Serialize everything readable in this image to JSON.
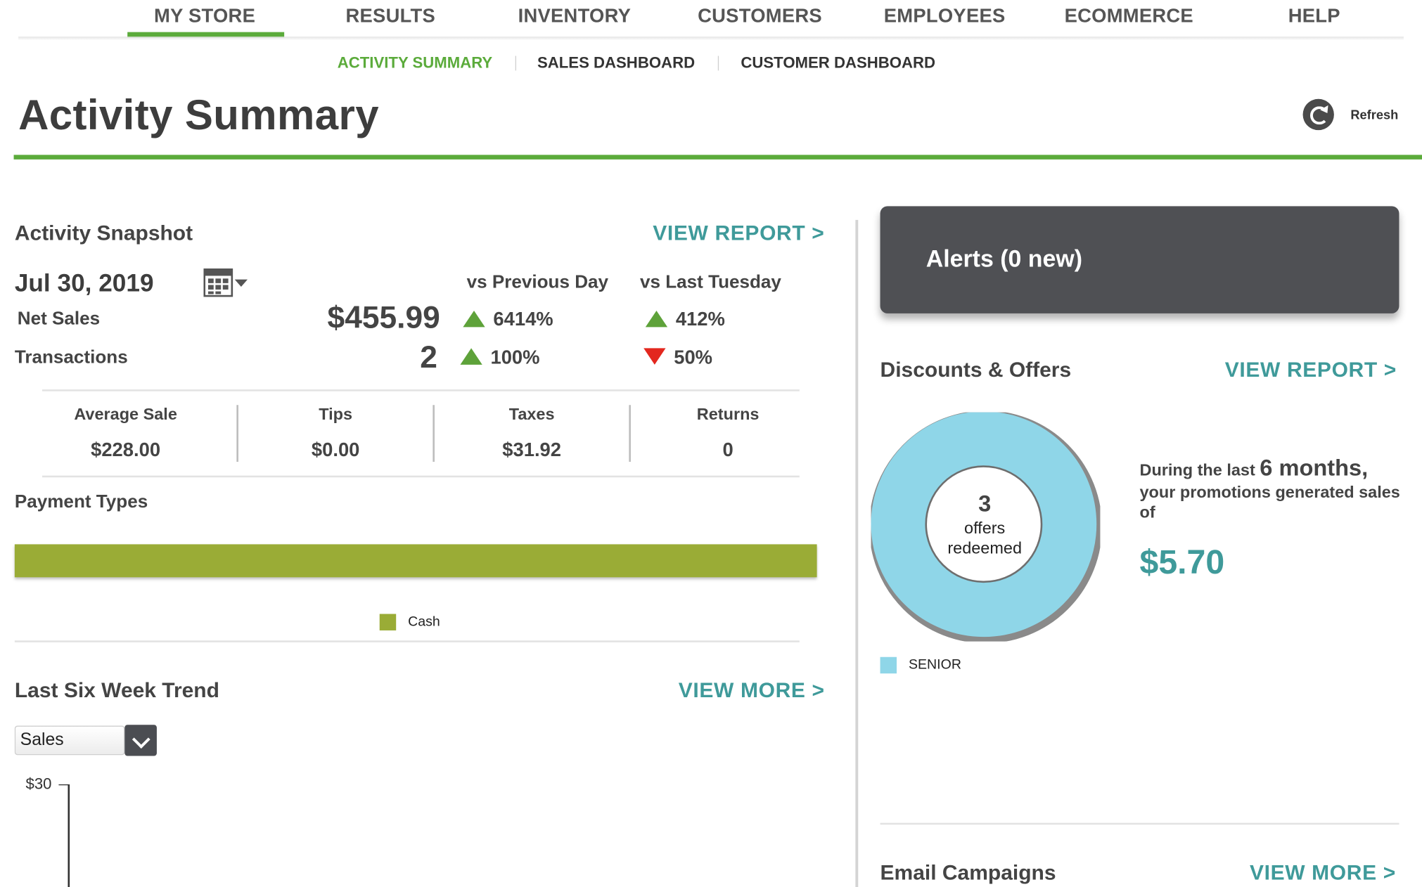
{
  "nav": {
    "items": [
      "MY STORE",
      "RESULTS",
      "INVENTORY",
      "CUSTOMERS",
      "EMPLOYEES",
      "ECOMMERCE",
      "HELP"
    ],
    "active": "MY STORE",
    "accent_color": "#5bab3b"
  },
  "subnav": {
    "items": [
      "ACTIVITY SUMMARY",
      "SALES DASHBOARD",
      "CUSTOMER DASHBOARD"
    ],
    "active": "ACTIVITY SUMMARY"
  },
  "page": {
    "title": "Activity Summary",
    "refresh_label": "Refresh",
    "refresh_icon": "refresh-icon"
  },
  "snapshot": {
    "title": "Activity Snapshot",
    "view_report": "VIEW REPORT >",
    "date": "Jul 30, 2019",
    "calendar_icon": "calendar-icon",
    "vs_prev_label": "vs Previous Day",
    "vs_last_label": "vs Last Tuesday",
    "rows": [
      {
        "label": "Net Sales",
        "value": "$455.99",
        "vs_prev": "6414%",
        "vs_prev_dir": "up",
        "vs_last": "412%",
        "vs_last_dir": "up"
      },
      {
        "label": "Transactions",
        "value": "2",
        "vs_prev": "100%",
        "vs_prev_dir": "up",
        "vs_last": "50%",
        "vs_last_dir": "down"
      }
    ],
    "stats": [
      {
        "label": "Average Sale",
        "value": "$228.00"
      },
      {
        "label": "Tips",
        "value": "$0.00"
      },
      {
        "label": "Taxes",
        "value": "$31.92"
      },
      {
        "label": "Returns",
        "value": "0"
      }
    ],
    "up_color": "#5ea23a",
    "down_color": "#e3271e"
  },
  "payment_types": {
    "title": "Payment Types",
    "legend": [
      {
        "label": "Cash",
        "color": "#9aac36",
        "share": 1.0
      }
    ]
  },
  "trend": {
    "title": "Last Six Week Trend",
    "view_more": "VIEW MORE >",
    "metric_selected": "Sales",
    "y_tick": "$30"
  },
  "alerts": {
    "title": "Alerts (0 new)"
  },
  "discounts": {
    "title": "Discounts & Offers",
    "view_report": "VIEW REPORT >",
    "offers_count": "3",
    "offers_line1": "offers",
    "offers_line2": "redeemed",
    "legend": [
      {
        "label": "SENIOR",
        "color": "#8fd6e8",
        "share": 1.0
      }
    ],
    "promo_prefix": "During the last ",
    "promo_period": "6 months,",
    "promo_line2": "your promotions generated sales",
    "promo_line3": "of",
    "promo_amount": "$5.70"
  },
  "email": {
    "title": "Email Campaigns",
    "view_more": "VIEW MORE >"
  },
  "teal_color": "#3f9a9a"
}
